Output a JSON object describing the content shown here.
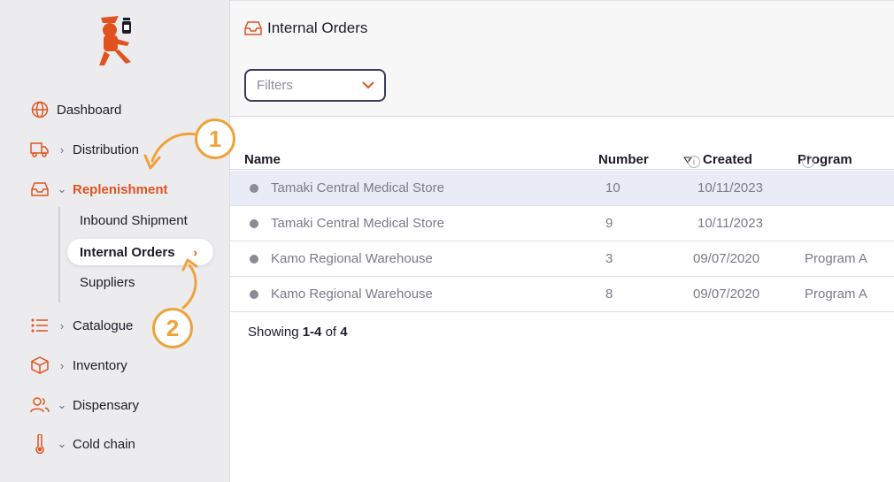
{
  "sidebar": {
    "nav": [
      {
        "label": "Dashboard",
        "icon": "globe-icon"
      },
      {
        "label": "Distribution",
        "icon": "truck-icon"
      },
      {
        "label": "Replenishment",
        "icon": "inbox-icon"
      },
      {
        "label": "Catalogue",
        "icon": "list-icon"
      },
      {
        "label": "Inventory",
        "icon": "box-icon"
      },
      {
        "label": "Dispensary",
        "icon": "users-icon"
      },
      {
        "label": "Cold chain",
        "icon": "thermometer-icon"
      }
    ],
    "sub_items": [
      "Inbound Shipment",
      "Internal Orders",
      "Suppliers"
    ]
  },
  "header": {
    "title": "Internal Orders",
    "filters_placeholder": "Filters"
  },
  "table": {
    "columns": [
      "Name",
      "Number",
      "Created",
      "Program"
    ],
    "rows": [
      {
        "name": "Tamaki Central Medical Store",
        "number": "10",
        "created": "10/11/2023",
        "program": ""
      },
      {
        "name": "Tamaki Central Medical Store",
        "number": "9",
        "created": "10/11/2023",
        "program": ""
      },
      {
        "name": "Kamo Regional Warehouse",
        "number": "3",
        "created": "09/07/2020",
        "program": "Program A"
      },
      {
        "name": "Kamo Regional Warehouse",
        "number": "8",
        "created": "09/07/2020",
        "program": "Program A"
      }
    ],
    "footer": {
      "prefix": "Showing ",
      "range": "1-4",
      "of": " of ",
      "total": "4"
    }
  },
  "annotations": {
    "callout_1": "1",
    "callout_2": "2"
  },
  "colors": {
    "accent": "#e0531f",
    "callout": "#f0a23a",
    "selected_row": "#e9ecf7"
  }
}
